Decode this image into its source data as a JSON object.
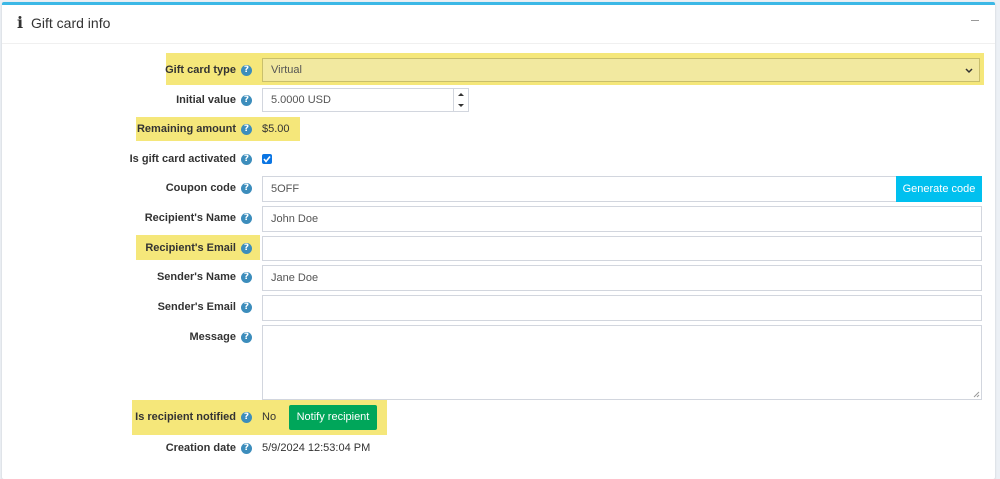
{
  "header": {
    "title": "Gift card info"
  },
  "fields": {
    "gift_card_type": {
      "label": "Gift card type",
      "value": "Virtual"
    },
    "initial_value": {
      "label": "Initial value",
      "value": "5.0000 USD"
    },
    "remaining_amount": {
      "label": "Remaining amount",
      "value": "$5.00"
    },
    "is_activated": {
      "label": "Is gift card activated",
      "checked": true
    },
    "coupon_code": {
      "label": "Coupon code",
      "value": "5OFF",
      "button": "Generate code"
    },
    "recipient_name": {
      "label": "Recipient's Name",
      "value": "John Doe"
    },
    "recipient_email": {
      "label": "Recipient's Email",
      "value": ""
    },
    "sender_name": {
      "label": "Sender's Name",
      "value": "Jane Doe"
    },
    "sender_email": {
      "label": "Sender's Email",
      "value": ""
    },
    "message": {
      "label": "Message",
      "value": ""
    },
    "is_notified": {
      "label": "Is recipient notified",
      "value": "No",
      "button": "Notify recipient"
    },
    "creation_date": {
      "label": "Creation date",
      "value": "5/9/2024 12:53:04 PM"
    }
  },
  "help_glyph": "?",
  "colors": {
    "highlight": "#f5e77a",
    "accent": "#00c0ef",
    "success": "#00a65a",
    "help": "#3c8dbc"
  }
}
